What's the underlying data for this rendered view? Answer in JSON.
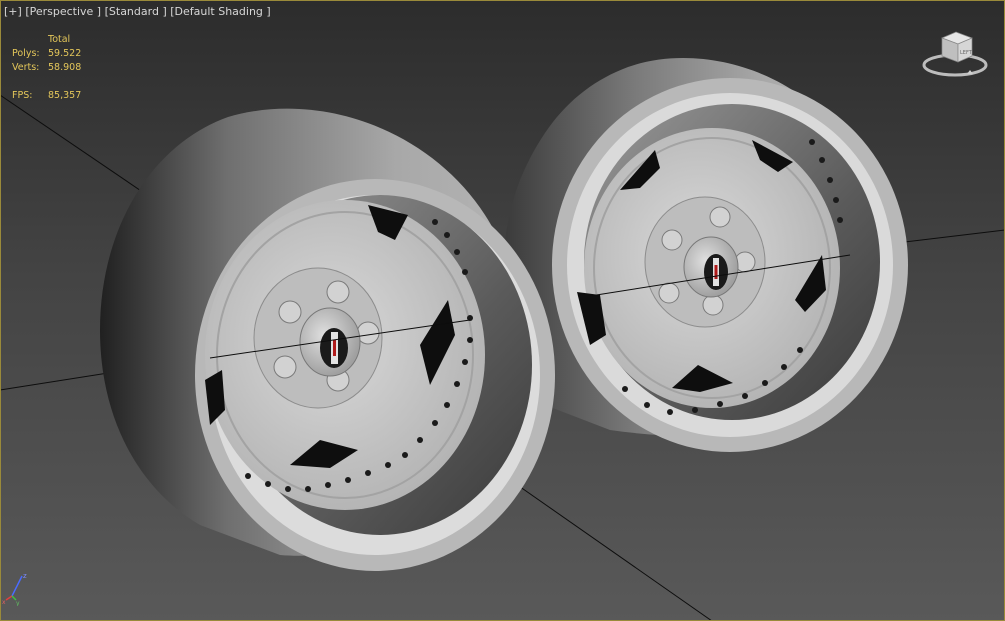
{
  "viewport": {
    "menu": "[+]",
    "view": "[Perspective ]",
    "preset": "[Standard ]",
    "shading": "[Default Shading ]"
  },
  "stats": {
    "header": "Total",
    "polys_label": "Polys:",
    "polys_value": "59.522",
    "verts_label": "Verts:",
    "verts_value": "58.908",
    "fps_label": "FPS:",
    "fps_value": "85,357"
  },
  "viewcube": {
    "face_label": "LEFT"
  },
  "gizmo": {
    "z_label": "z",
    "x_label": "x",
    "y_label": "y"
  },
  "colors": {
    "stats_text": "#e3c65a",
    "border": "#9a8a3a",
    "wheel": "#c8c8c8"
  }
}
